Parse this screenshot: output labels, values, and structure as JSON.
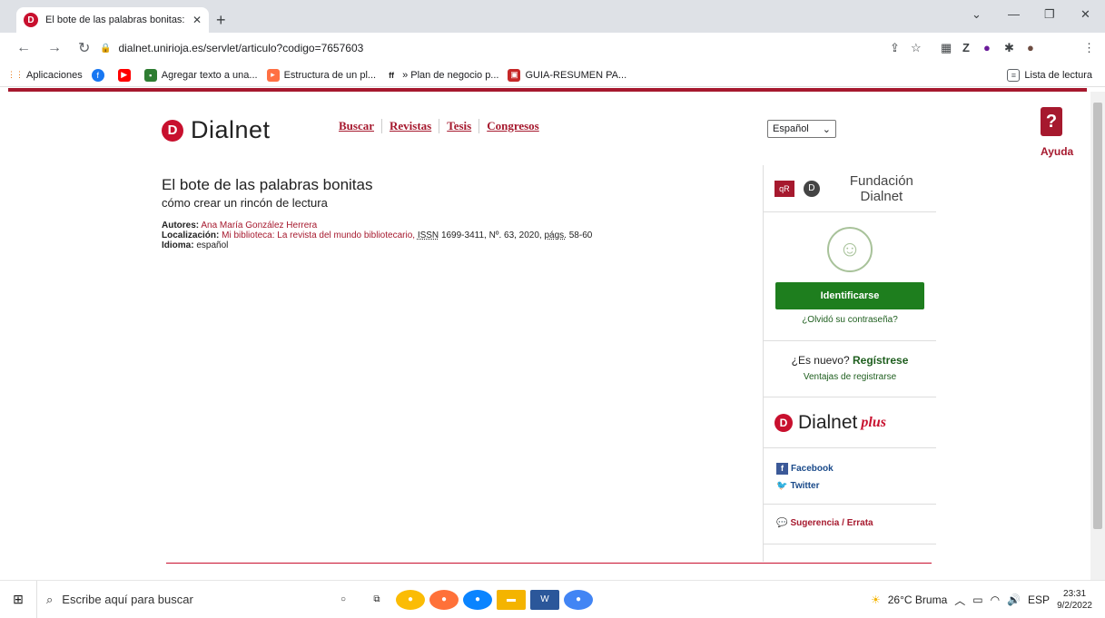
{
  "browser": {
    "tab_title": "El bote de las palabras bonitas: c",
    "url": "dialnet.unirioja.es/servlet/articulo?codigo=7657603",
    "bookmarks": [
      {
        "label": "Aplicaciones"
      },
      {
        "label": "Agregar texto a una..."
      },
      {
        "label": "Estructura de un pl..."
      },
      {
        "label": "» Plan de negocio p..."
      },
      {
        "label": "GUIA-RESUMEN PA..."
      }
    ],
    "reading_list": "Lista de lectura"
  },
  "site": {
    "logo": "Dialnet",
    "menu": [
      "Buscar",
      "Revistas",
      "Tesis",
      "Congresos"
    ],
    "language": "Español",
    "help": "Ayuda"
  },
  "article": {
    "title": "El bote de las palabras bonitas",
    "subtitle": "cómo crear un rincón de lectura",
    "authors_label": "Autores:",
    "authors": "Ana María González Herrera",
    "location_label": "Localización:",
    "location": "Mi biblioteca: La revista del mundo bibliotecario,",
    "issn_label": "ISSN",
    "issn": "1699-3411, Nº. 63, 2020,",
    "pags_label": "págs.",
    "pags": "58-60",
    "language_label": "Idioma:",
    "language": "español"
  },
  "sidebar": {
    "foundation": "Fundación Dialnet",
    "login_button": "Identificarse",
    "forgot": "¿Olvidó su contraseña?",
    "new_q": "¿Es nuevo?",
    "register": "Regístrese",
    "advantages": "Ventajas de registrarse",
    "plus_logo": "Dialnet",
    "plus_word": "plus",
    "facebook": "Facebook",
    "twitter": "Twitter",
    "suggestion": "Sugerencia / Errata"
  },
  "taskbar": {
    "search_placeholder": "Escribe aquí para buscar",
    "weather": "26°C Bruma",
    "lang": "ESP",
    "time": "23:31",
    "date": "9/2/2022"
  }
}
